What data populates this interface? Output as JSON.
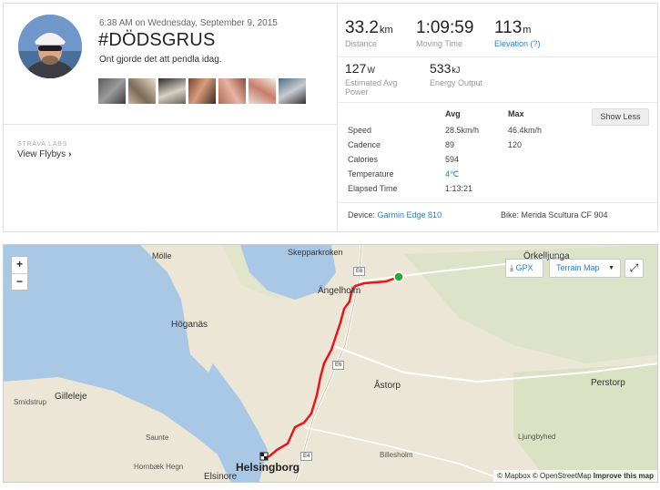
{
  "activity": {
    "date": "6:38 AM on Wednesday, September 9, 2015",
    "title": "#DÖDSGRUS",
    "description": "Ont gjorde det att pendla idag."
  },
  "labs": {
    "label": "STRAVA LABS",
    "flybys": "View Flybys"
  },
  "stats": {
    "distance": {
      "value": "33.2",
      "unit": "km",
      "label": "Distance"
    },
    "moving_time": {
      "value": "1:09:59",
      "label": "Moving Time"
    },
    "elevation": {
      "value": "113",
      "unit": "m",
      "label": "Elevation (?)"
    },
    "power": {
      "value": "127",
      "unit": "W",
      "label_line1": "Estimated Avg",
      "label_line2": "Power"
    },
    "energy": {
      "value": "533",
      "unit": "kJ",
      "label": "Energy Output"
    }
  },
  "table": {
    "avg_header": "Avg",
    "max_header": "Max",
    "show_less": "Show Less",
    "rows": [
      {
        "label": "Speed",
        "avg": "28.5km/h",
        "max": "46.4km/h"
      },
      {
        "label": "Cadence",
        "avg": "89",
        "max": "120"
      },
      {
        "label": "Calories",
        "avg": "594",
        "max": ""
      },
      {
        "label": "Temperature",
        "avg": "4℃",
        "max": ""
      },
      {
        "label": "Elapsed Time",
        "avg": "1:13:21",
        "max": ""
      }
    ]
  },
  "device": {
    "label": "Device:",
    "name": "Garmin Edge 810"
  },
  "bike": {
    "text": "Bike: Merida Scultura CF 904"
  },
  "map": {
    "gpx": "GPX",
    "terrain": "Terrain Map",
    "zoom_in": "+",
    "zoom_out": "−",
    "labels": {
      "skepparkroken": "Skepparkroken",
      "orkelljunga": "Örkelljunga",
      "molle": "Mölle",
      "angelholm": "Ängelholm",
      "hoganas": "Höganäs",
      "astorp": "Åstorp",
      "perstorp": "Perstorp",
      "smidstrup": "Smidstrup",
      "gilleleje": "Gilleleje",
      "ljungbyhed": "Ljungbyhed",
      "saunte": "Saunte",
      "billesholm": "Billesholm",
      "hornbaek": "Hornbæk Hegn",
      "helsingborg": "Helsingborg",
      "elsinore": "Elsinore"
    },
    "roads": {
      "e6a": "E6",
      "e6b": "E6",
      "e4": "E4"
    },
    "attribution": {
      "mapbox": "© Mapbox",
      "osm": "© OpenStreetMap",
      "improve": "Improve this map"
    },
    "colors": {
      "route": "#e8161b",
      "start": "#2aa838",
      "water": "#a8c8e6",
      "land": "#ece6d6"
    }
  }
}
